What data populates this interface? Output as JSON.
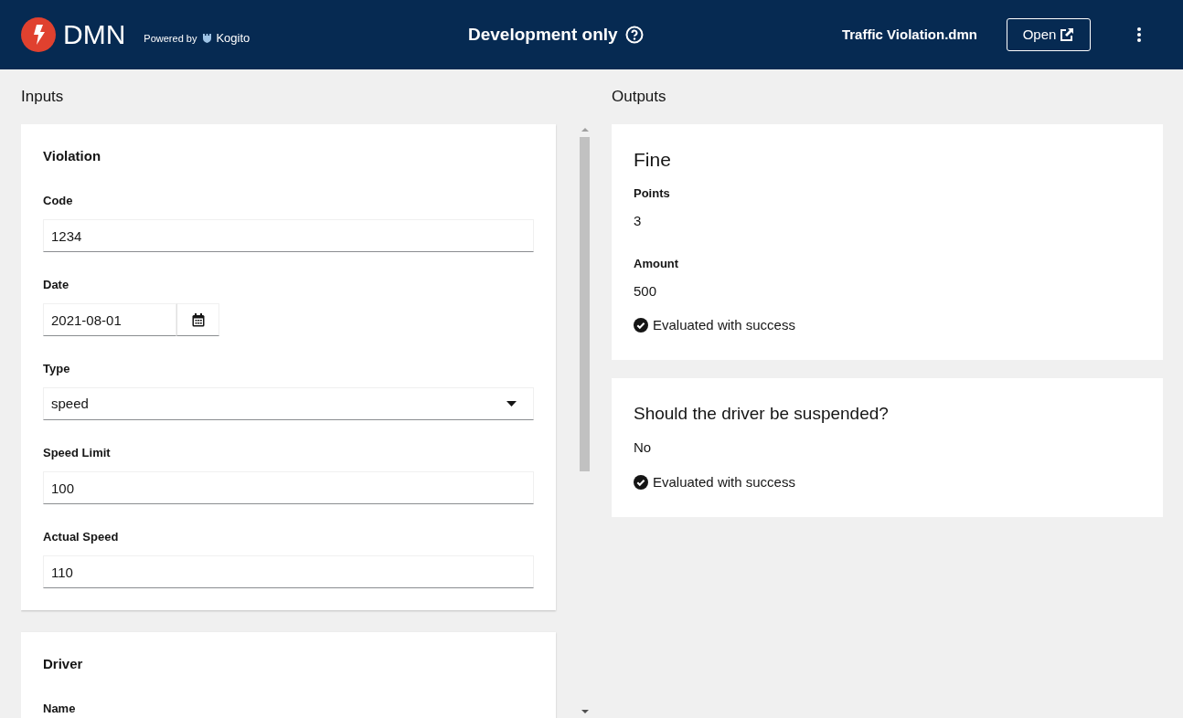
{
  "header": {
    "product": "DMN",
    "powered_by": "Powered by",
    "brand": "Kogito",
    "notice": "Development only",
    "file_name": "Traffic Violation.dmn",
    "open_button": "Open"
  },
  "inputs": {
    "title": "Inputs",
    "sections": [
      {
        "title": "Violation",
        "fields": [
          {
            "kind": "text",
            "label": "Code",
            "value": "1234"
          },
          {
            "kind": "date",
            "label": "Date",
            "value": "2021-08-01"
          },
          {
            "kind": "select",
            "label": "Type",
            "value": "speed"
          },
          {
            "kind": "text",
            "label": "Speed Limit",
            "value": "100"
          },
          {
            "kind": "text",
            "label": "Actual Speed",
            "value": "110"
          }
        ]
      },
      {
        "title": "Driver",
        "fields": [
          {
            "label": "Name"
          }
        ]
      }
    ]
  },
  "outputs": {
    "title": "Outputs",
    "cards": [
      {
        "kind": "context",
        "title": "Fine",
        "entries": [
          {
            "label": "Points",
            "value": "3"
          },
          {
            "label": "Amount",
            "value": "500"
          }
        ],
        "status": "Evaluated with success"
      },
      {
        "kind": "value",
        "title": "Should the driver be suspended?",
        "value": "No",
        "status": "Evaluated with success"
      }
    ]
  }
}
